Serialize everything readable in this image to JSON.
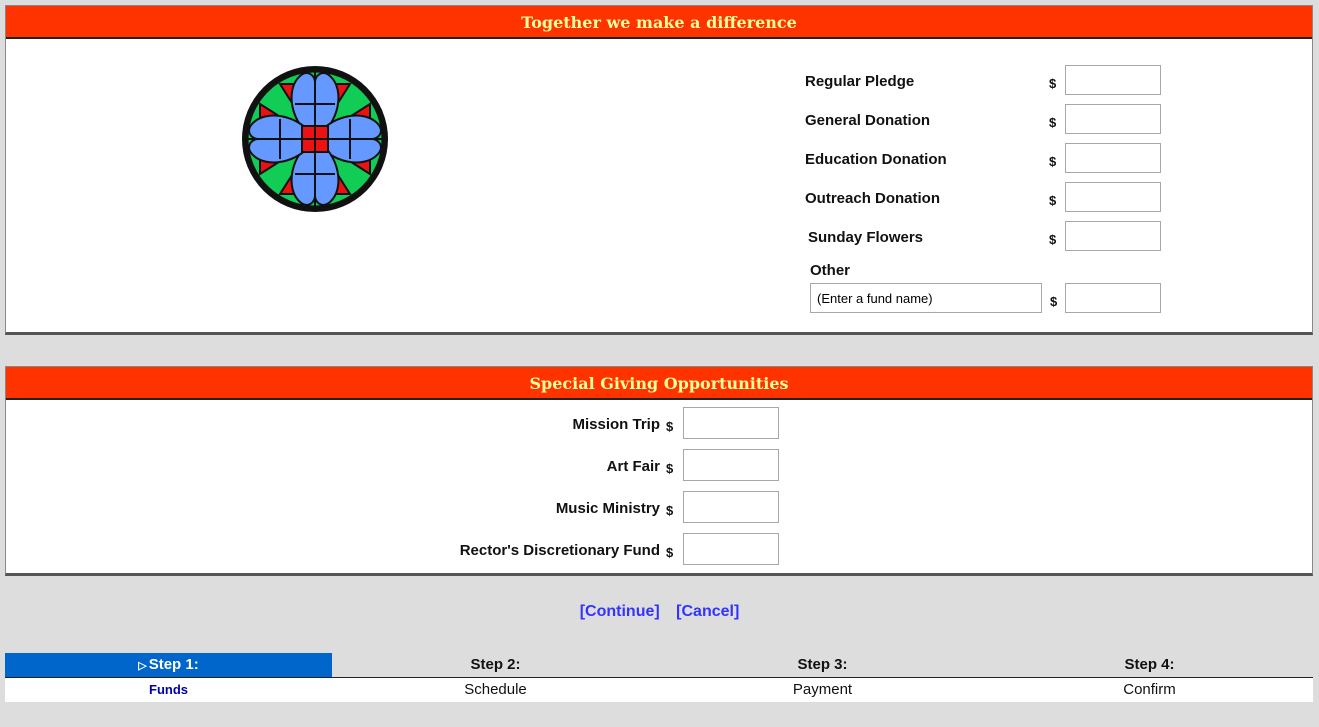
{
  "panel1": {
    "title": "Together we make a difference"
  },
  "funds": [
    {
      "label": "Regular Pledge",
      "currency": "$",
      "amount": ""
    },
    {
      "label": "General Donation",
      "currency": "$",
      "amount": ""
    },
    {
      "label": "Education Donation",
      "currency": "$",
      "amount": ""
    },
    {
      "label": "Outreach Donation",
      "currency": "$",
      "amount": ""
    },
    {
      "label": "Sunday Flowers",
      "currency": "$",
      "amount": ""
    }
  ],
  "other": {
    "label": "Other",
    "name_value": "(Enter a fund name)",
    "currency": "$",
    "amount": ""
  },
  "panel2": {
    "title": "Special Giving Opportunities"
  },
  "special": [
    {
      "label": "Mission Trip",
      "currency": "$",
      "amount": ""
    },
    {
      "label": "Art Fair",
      "currency": "$",
      "amount": ""
    },
    {
      "label": "Music Ministry",
      "currency": "$",
      "amount": ""
    },
    {
      "label": "Rector's Discretionary Fund",
      "currency": "$",
      "amount": ""
    }
  ],
  "actions": {
    "continue": "[Continue]",
    "cancel": "[Cancel]"
  },
  "steps": [
    {
      "label": "Step 1:",
      "name": "Funds",
      "active": true
    },
    {
      "label": "Step 2:",
      "name": "Schedule",
      "active": false
    },
    {
      "label": "Step 3:",
      "name": "Payment",
      "active": false
    },
    {
      "label": "Step 4:",
      "name": "Confirm",
      "active": false
    }
  ],
  "colors": {
    "header_bg": "#ff3300",
    "header_text": "#ffff99",
    "active_step": "#0066cc",
    "link": "#3333ff",
    "page_bg": "#dddddd"
  },
  "icons": {
    "logo": "stained-glass-rose-window-icon",
    "step_marker": "triangle-right-icon"
  }
}
